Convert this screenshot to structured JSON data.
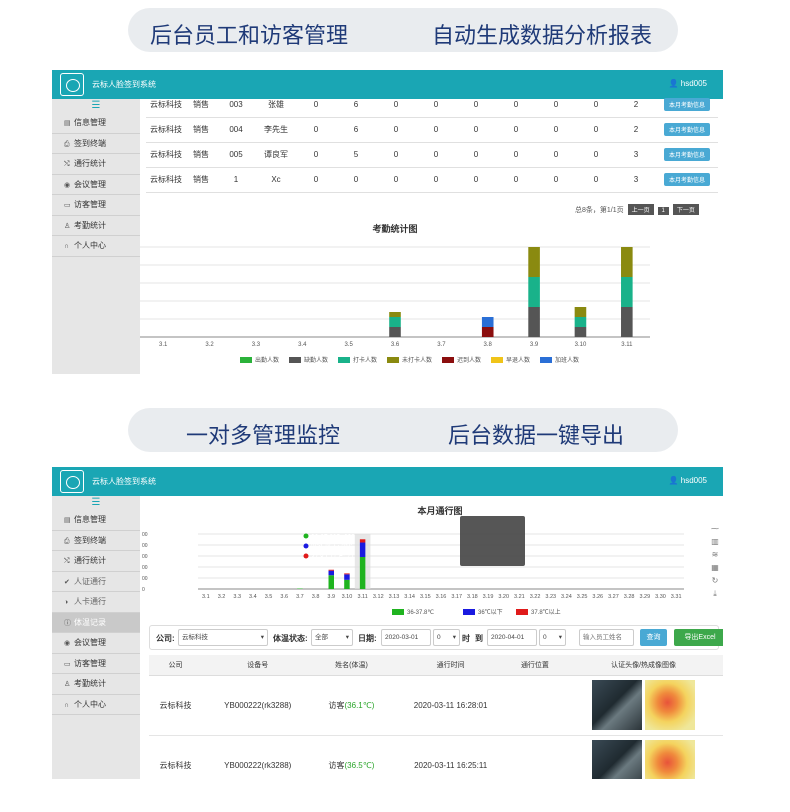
{
  "banners": {
    "top_left": "后台员工和访客管理",
    "top_right": "自动生成数据分析报表",
    "mid_left": "一对多管理监控",
    "mid_right": "后台数据一键导出"
  },
  "app": {
    "title": "云标人脸签到系统",
    "user": "hsd005"
  },
  "sidebar1": [
    {
      "label": "信息管理",
      "icon": "list-icon"
    },
    {
      "label": "签到终端",
      "icon": "printer-icon"
    },
    {
      "label": "通行统计",
      "icon": "shuffle-icon"
    },
    {
      "label": "会议管理",
      "icon": "globe-icon"
    },
    {
      "label": "访客管理",
      "icon": "comment-icon"
    },
    {
      "label": "考勤统计",
      "icon": "user-tie-icon"
    },
    {
      "label": "个人中心",
      "icon": "headphones-icon"
    }
  ],
  "attendance_table": {
    "rows": [
      [
        "云标科技",
        "销售",
        "003",
        "张雄",
        "0",
        "6",
        "0",
        "0",
        "0",
        "0",
        "0",
        "0",
        "2"
      ],
      [
        "云标科技",
        "销售",
        "004",
        "李先生",
        "0",
        "6",
        "0",
        "0",
        "0",
        "0",
        "0",
        "0",
        "2"
      ],
      [
        "云标科技",
        "销售",
        "005",
        "谭良军",
        "0",
        "5",
        "0",
        "0",
        "0",
        "0",
        "0",
        "0",
        "3"
      ],
      [
        "云标科技",
        "销售",
        "1",
        "Xc",
        "0",
        "0",
        "0",
        "0",
        "0",
        "0",
        "0",
        "0",
        "3"
      ]
    ],
    "row_button": "本月考勤信息",
    "pager": {
      "summary": "总8条，第1/1页",
      "prev": "上一页",
      "page": "1",
      "next": "下一页"
    }
  },
  "chart_data": [
    {
      "type": "bar",
      "title": "考勤统计图",
      "categories": [
        "3.1",
        "3.2",
        "3.3",
        "3.4",
        "3.5",
        "3.6",
        "3.7",
        "3.8",
        "3.9",
        "3.10",
        "3.11"
      ],
      "stacked": true,
      "series": [
        {
          "name": "出勤人数",
          "color": "#2bb23a",
          "values": [
            0,
            0,
            0,
            0,
            0,
            0,
            0,
            0,
            0,
            0,
            0
          ]
        },
        {
          "name": "缺勤人数",
          "color": "#555555",
          "values": [
            0,
            0,
            0,
            0,
            0,
            1,
            0,
            0,
            3,
            1,
            3
          ]
        },
        {
          "name": "打卡人数",
          "color": "#19b28a",
          "values": [
            0,
            0,
            0,
            0,
            0,
            1,
            0,
            0,
            3,
            1,
            3
          ]
        },
        {
          "name": "未打卡人数",
          "color": "#8a8a10",
          "values": [
            0,
            0,
            0,
            0,
            0,
            0.5,
            0,
            0,
            3,
            1,
            3
          ]
        },
        {
          "name": "迟到人数",
          "color": "#8b0e0e",
          "values": [
            0,
            0,
            0,
            0,
            0,
            0,
            0,
            1,
            0,
            0,
            0
          ]
        },
        {
          "name": "早退人数",
          "color": "#f0c419",
          "values": [
            0,
            0,
            0,
            0,
            0,
            0,
            0,
            0,
            0,
            0,
            0
          ]
        },
        {
          "name": "加班人数",
          "color": "#2a6fd6",
          "values": [
            0,
            0,
            0,
            0,
            0,
            0,
            0,
            1,
            0,
            0,
            0
          ]
        }
      ]
    },
    {
      "type": "bar",
      "title": "本月通行图",
      "categories": [
        "3.1",
        "3.2",
        "3.3",
        "3.4",
        "3.5",
        "3.6",
        "3.7",
        "3.8",
        "3.9",
        "3.10",
        "3.11",
        "3.12",
        "3.13",
        "3.14",
        "3.15",
        "3.16",
        "3.17",
        "3.18",
        "3.19",
        "3.20",
        "3.21",
        "3.22",
        "3.23",
        "3.24",
        "3.25",
        "3.26",
        "3.27",
        "3.28",
        "3.29",
        "3.30",
        "3.31"
      ],
      "stacked": true,
      "tooltip": {
        "title": "3.11",
        "lines": [
          "36-37.8℃: 698",
          "36℃以下: 316",
          "37.8℃以上: 71"
        ]
      },
      "series": [
        {
          "name": "36-37.8℃",
          "color": "#1fb31f",
          "values": [
            0,
            0,
            0,
            0,
            0,
            0,
            10,
            0,
            300,
            200,
            698,
            0,
            0,
            0,
            0,
            0,
            0,
            0,
            0,
            0,
            0,
            0,
            0,
            0,
            0,
            0,
            0,
            0,
            0,
            0,
            0
          ]
        },
        {
          "name": "36℃以下",
          "color": "#1a1ae0",
          "values": [
            0,
            0,
            0,
            0,
            0,
            0,
            0,
            0,
            100,
            120,
            316,
            0,
            0,
            0,
            0,
            0,
            0,
            0,
            0,
            0,
            0,
            0,
            0,
            0,
            0,
            0,
            0,
            0,
            0,
            0,
            0
          ]
        },
        {
          "name": "37.8℃以上",
          "color": "#e01a1a",
          "values": [
            0,
            0,
            0,
            0,
            0,
            0,
            0,
            0,
            20,
            20,
            71,
            0,
            0,
            0,
            0,
            0,
            0,
            0,
            0,
            0,
            0,
            0,
            0,
            0,
            0,
            0,
            0,
            0,
            0,
            0,
            0
          ]
        }
      ]
    }
  ],
  "sidebar2": [
    {
      "label": "信息管理",
      "icon": "list-icon"
    },
    {
      "label": "签到终端",
      "icon": "printer-icon"
    },
    {
      "label": "通行统计",
      "icon": "shuffle-icon"
    },
    {
      "label": "人证通行",
      "icon": "check-circle-icon",
      "sub": true
    },
    {
      "label": "人卡通行",
      "icon": "half-circle-icon",
      "sub": true
    },
    {
      "label": "体温记录",
      "icon": "info-icon",
      "active": true
    },
    {
      "label": "会议管理",
      "icon": "globe-icon"
    },
    {
      "label": "访客管理",
      "icon": "comment-icon"
    },
    {
      "label": "考勤统计",
      "icon": "user-tie-icon"
    },
    {
      "label": "个人中心",
      "icon": "headphones-icon"
    }
  ],
  "filter": {
    "company_label": "公司:",
    "company_value": "云标科技",
    "temp_label": "体温状态:",
    "temp_value": "全部",
    "date_label": "日期:",
    "date_from": "2020-03-01",
    "hour_from": "0",
    "hour_unit": "时",
    "to_label": "到",
    "date_to": "2020-04-01",
    "hour_to": "0",
    "name_placeholder": "输入员工姓名",
    "search_button": "查询",
    "export_button": "导出Excel"
  },
  "records_table": {
    "headers": [
      "公司",
      "设备号",
      "姓名(体温)",
      "通行时间",
      "通行位置",
      "认证头像/热成像图像"
    ],
    "rows": [
      {
        "company": "云标科技",
        "device": "YB000222(rk3288)",
        "name": "访客",
        "temp": "(36.1℃)",
        "time": "2020-03-11 16:28:01",
        "location": ""
      },
      {
        "company": "云标科技",
        "device": "YB000222(rk3288)",
        "name": "访客",
        "temp": "(36.5℃)",
        "time": "2020-03-11 16:25:11",
        "location": ""
      }
    ]
  }
}
